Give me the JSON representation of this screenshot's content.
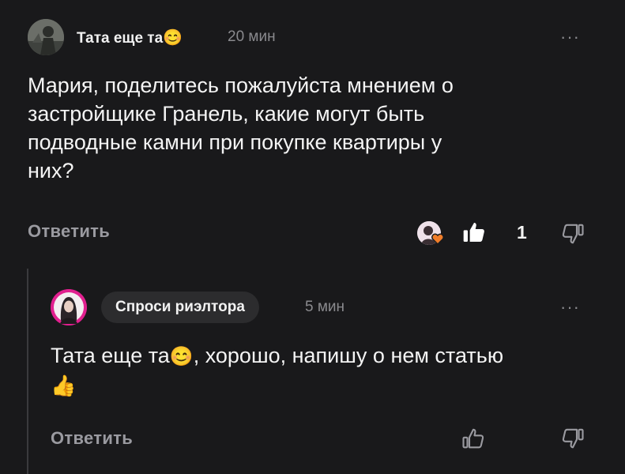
{
  "comment": {
    "author": "Тата еще та",
    "author_emoji": "😊",
    "time": "20 мин",
    "more": "···",
    "text_lines": [
      "Мария, поделитесь пожалуйста мнением о",
      "застройщике Гранель, какие могут быть",
      "подводные камни при покупке квартиры у",
      "них?"
    ],
    "reply_label": "Ответить",
    "likes": "1"
  },
  "reply": {
    "author": "Спроси риэлтора",
    "time": "5 мин",
    "more": "···",
    "mention": "Тата еще та",
    "mention_emoji": "😊",
    "text": ", хорошо, напишу о нем статью",
    "text_emoji": "👍",
    "reply_label": "Ответить"
  },
  "colors": {
    "background": "#19191b",
    "text": "#f4f4f4",
    "muted": "#8a8a8e",
    "pill": "#2c2c2e"
  }
}
